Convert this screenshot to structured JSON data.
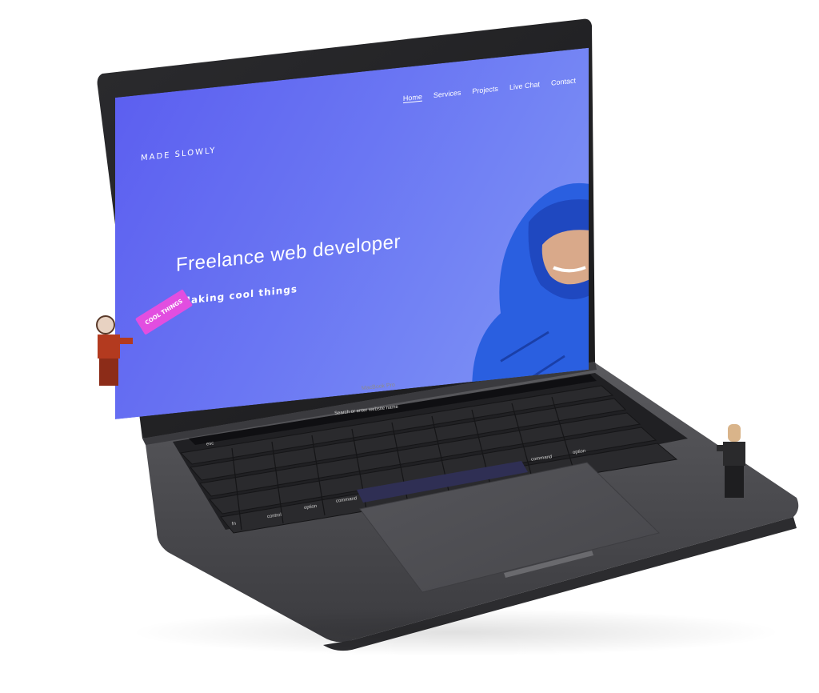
{
  "site": {
    "brand": "MADE SLOWLY",
    "nav": [
      {
        "label": "Home",
        "active": true
      },
      {
        "label": "Services",
        "active": false
      },
      {
        "label": "Projects",
        "active": false
      },
      {
        "label": "Live Chat",
        "active": false
      },
      {
        "label": "Contact",
        "active": false
      }
    ],
    "hero_title": "Freelance web developer",
    "hero_subtitle": "Making cool things"
  },
  "device": {
    "model_label": "MacBook Pro",
    "touchbar_search": "Search or enter website name",
    "keys": {
      "esc": "esc",
      "command_right": "command",
      "option_right": "option",
      "command_left": "command",
      "option_left": "option",
      "control": "control",
      "fn": "fn"
    }
  },
  "sticker": {
    "text": "COOL THINGS"
  },
  "colors": {
    "screen_start": "#5c5ff0",
    "screen_end": "#7f95f5",
    "laptop_body": "#4a4a4d",
    "keyboard": "#1c1c1e",
    "hood": "#2a5fe0",
    "sticker": "#e24ee0"
  }
}
